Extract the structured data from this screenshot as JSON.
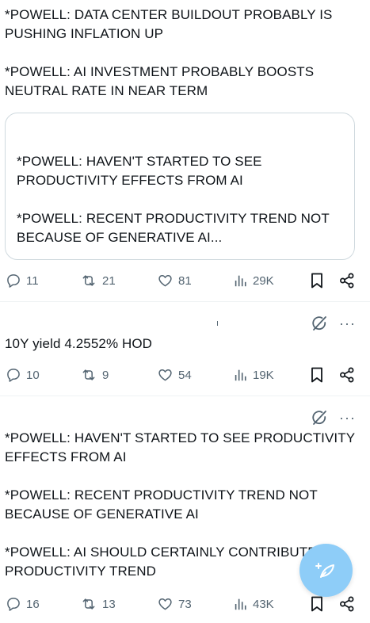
{
  "posts": [
    {
      "text": "*POWELL: DATA CENTER BUILDOUT PROBABLY IS PUSHING INFLATION UP\n\n*POWELL: AI INVESTMENT PROBABLY BOOSTS NEUTRAL RATE IN NEAR TERM",
      "quote": {
        "text": "*POWELL: HAVEN'T STARTED TO SEE PRODUCTIVITY EFFECTS FROM AI\n\n*POWELL: RECENT PRODUCTIVITY TREND NOT BECAUSE OF GENERATIVE AI..."
      },
      "actions": {
        "replies": "11",
        "reposts": "21",
        "likes": "81",
        "views": "29K"
      }
    },
    {
      "text": "10Y yield 4.2552% HOD",
      "actions": {
        "replies": "10",
        "reposts": "9",
        "likes": "54",
        "views": "19K"
      }
    },
    {
      "text": "*POWELL: HAVEN'T STARTED TO SEE PRODUCTIVITY EFFECTS FROM AI\n\n*POWELL: RECENT PRODUCTIVITY TREND NOT BECAUSE OF GENERATIVE AI\n\n*POWELL: AI SHOULD CERTAINLY CONTRIBUTE TO PRODUCTIVITY TREND",
      "actions": {
        "replies": "16",
        "reposts": "13",
        "likes": "73",
        "views": "43K"
      }
    }
  ],
  "misc": {
    "tiny_mark": "ı",
    "more": "···"
  },
  "colors": {
    "text": "#0f1419",
    "muted": "#536471",
    "border": "#cfd9de",
    "fab": "#8ecdf8"
  }
}
